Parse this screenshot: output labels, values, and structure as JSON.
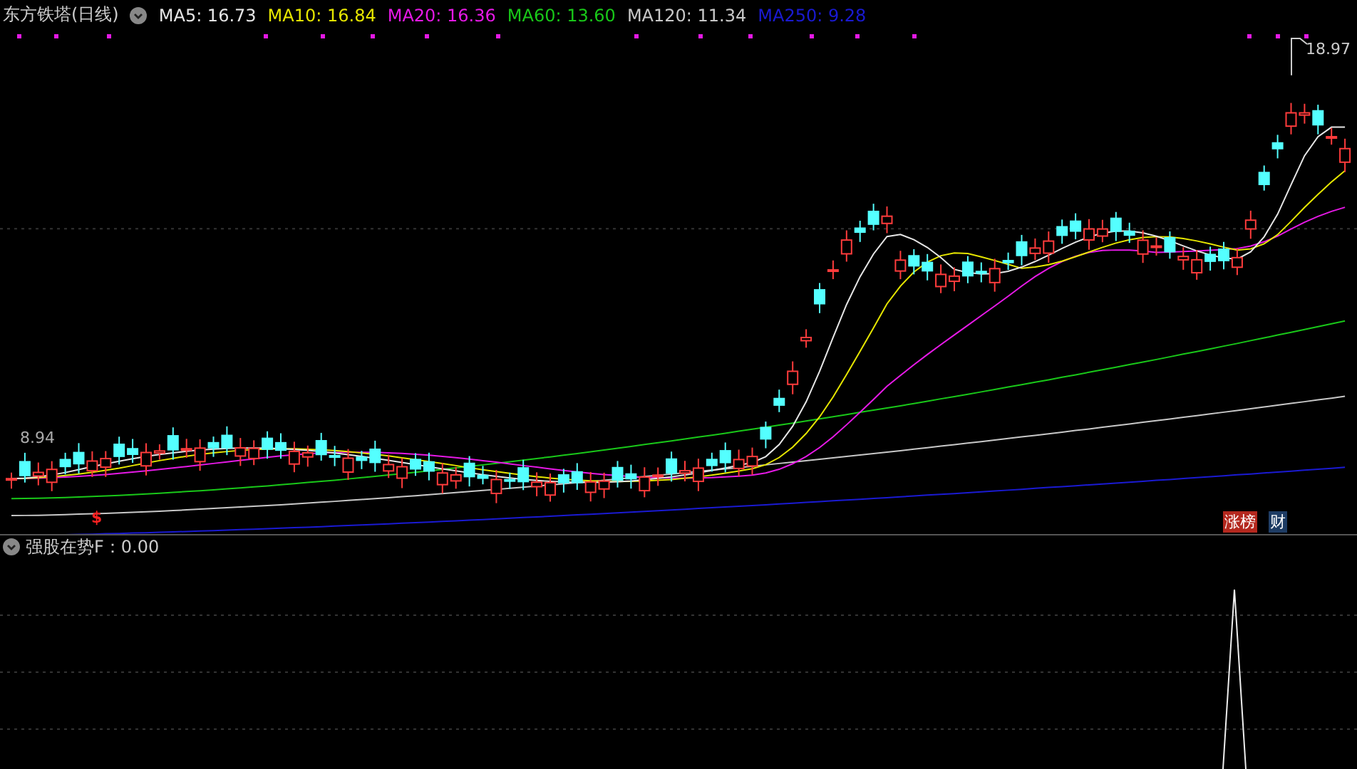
{
  "header": {
    "title": "东方铁塔(日线)",
    "indicators": [
      {
        "name": "MA5:",
        "value": "16.73",
        "color": "#e6e6e6"
      },
      {
        "name": "MA10:",
        "value": "16.84",
        "color": "#e6e600"
      },
      {
        "name": "MA20:",
        "value": "16.36",
        "color": "#e619e6"
      },
      {
        "name": "MA60:",
        "value": "13.60",
        "color": "#19c819"
      },
      {
        "name": "MA120:",
        "value": "11.34",
        "color": "#c8c8c8"
      },
      {
        "name": "MA250:",
        "value": "9.28",
        "color": "#1a1ad2"
      }
    ]
  },
  "main_chart": {
    "high_label": "18.97",
    "low_label": "8.94",
    "signal_mark": "$",
    "badges": [
      {
        "label": "涨榜",
        "color": "#b4281e"
      },
      {
        "label": "财",
        "color": "#1e3c64"
      }
    ]
  },
  "sub_panel": {
    "label": "强股在势F：0.00"
  }
}
